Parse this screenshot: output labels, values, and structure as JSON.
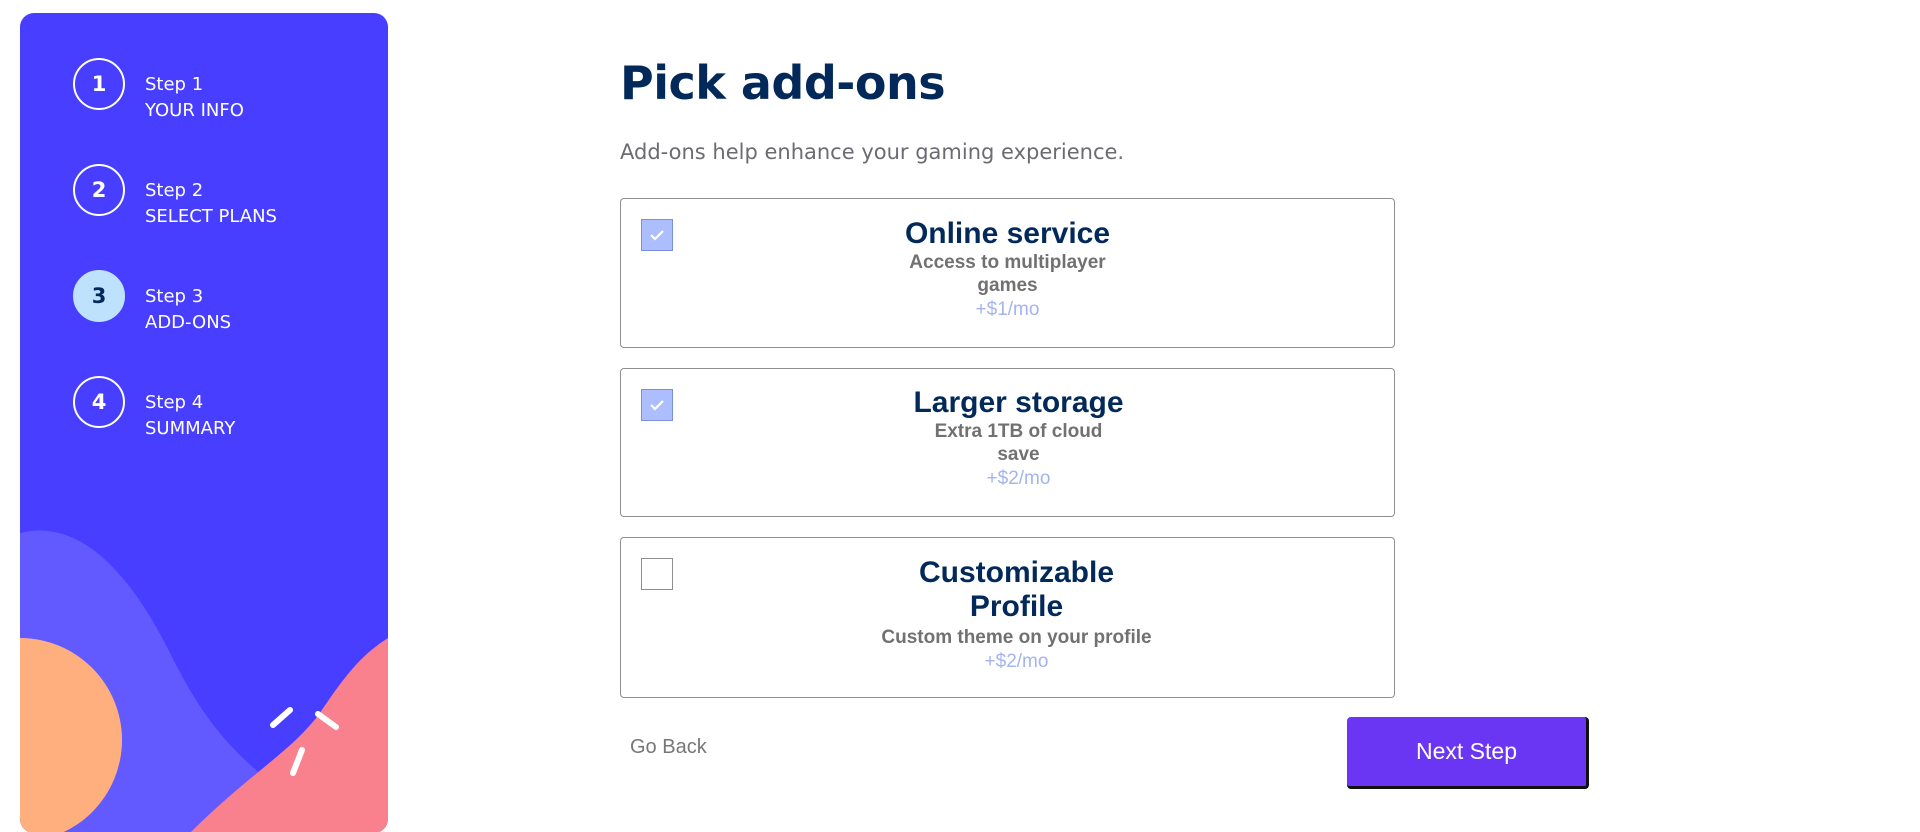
{
  "sidebar": {
    "steps": [
      {
        "number": "1",
        "label": "Step 1",
        "name": "YOUR INFO",
        "active": false
      },
      {
        "number": "2",
        "label": "Step 2",
        "name": "SELECT PLANS",
        "active": false
      },
      {
        "number": "3",
        "label": "Step 3",
        "name": "ADD-ONS",
        "active": true
      },
      {
        "number": "4",
        "label": "Step 4",
        "name": "SUMMARY",
        "active": false
      }
    ],
    "colors": {
      "background": "#483eff",
      "active_step": "#bee2fd",
      "blob_peach": "#ffaf7e",
      "blob_pink": "#f9818e",
      "blob_lavender": "#6259ff"
    }
  },
  "main": {
    "title": "Pick add-ons",
    "subtitle": "Add-ons help enhance your gaming experience.",
    "addons": [
      {
        "title": "Online service",
        "desc_lines": [
          "Access to multiplayer",
          "games"
        ],
        "price": "+$1/mo",
        "checked": true
      },
      {
        "title": "Larger storage",
        "desc_lines": [
          "Extra 1TB of cloud",
          "save"
        ],
        "price": "+$2/mo",
        "checked": true
      },
      {
        "title_lines": [
          "Customizable",
          "Profile"
        ],
        "desc": "Custom theme on your profile",
        "price": "+$2/mo",
        "checked": false
      }
    ],
    "back_label": "Go Back",
    "next_label": "Next Step",
    "colors": {
      "title": "#02295a",
      "next_button": "#6b36f3",
      "checkbox_checked": "#adbeff"
    }
  }
}
